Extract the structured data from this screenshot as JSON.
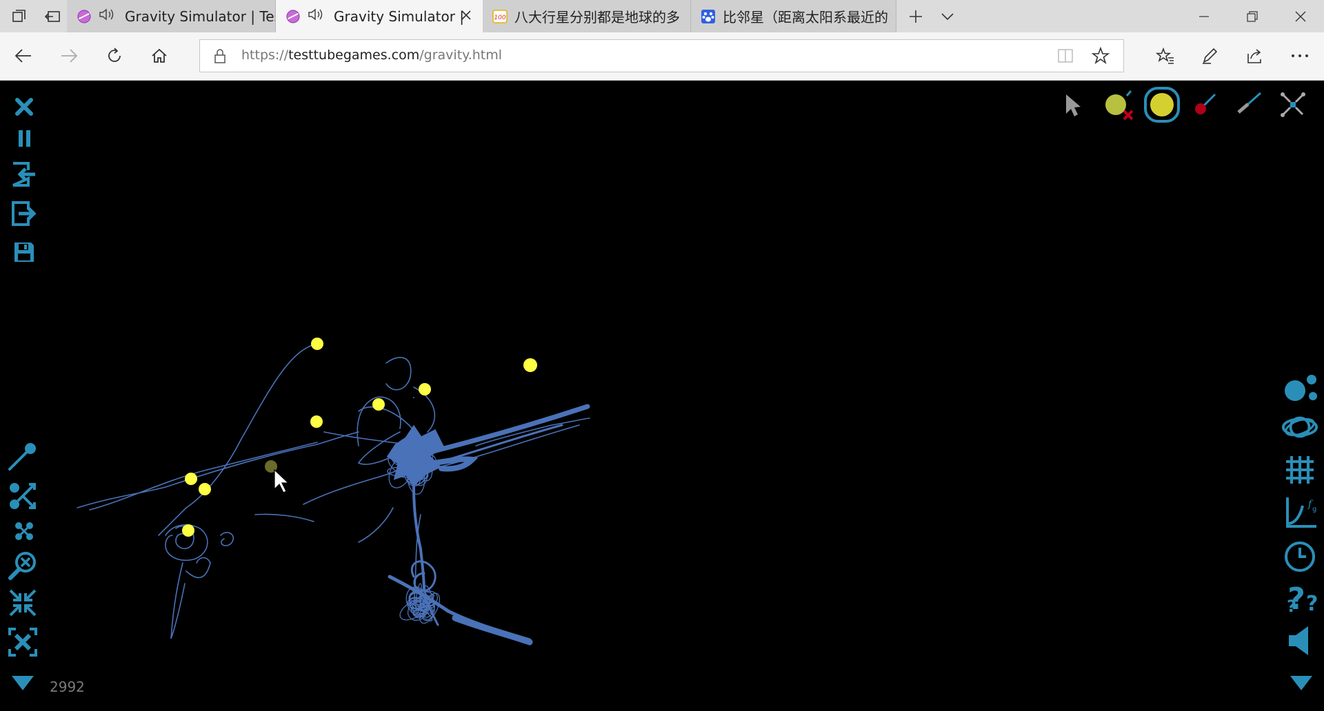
{
  "browser": {
    "tabs": [
      {
        "title": "Gravity Simulator | Test",
        "active": false,
        "favicon": "planet-icon",
        "audio": true
      },
      {
        "title": "Gravity Simulator |",
        "active": true,
        "favicon": "planet-icon",
        "audio": true
      },
      {
        "title": "八大行星分别都是地球的多",
        "active": false,
        "favicon": "page-icon"
      },
      {
        "title": "比邻星（距离太阳系最近的",
        "active": false,
        "favicon": "paw-icon"
      }
    ],
    "url": {
      "scheme": "https://",
      "host": "testtubegames.com",
      "path": "/gravity.html"
    }
  },
  "simulator": {
    "counter": "2992",
    "colors": {
      "background": "#000000",
      "ui": "#2a8fb8",
      "trail": "#4a72b8",
      "body": "#ffff44",
      "ghost_body": "#6b6b2a",
      "tool_red": "#b00018"
    },
    "left_tools": [
      "close-icon",
      "pause-icon",
      "import-icon",
      "export-icon",
      "save-icon",
      "velocity-tool-icon",
      "shuffle-icon",
      "collide-icon",
      "zoom-icon",
      "collapse-icon",
      "center-icon",
      "menu-down-icon"
    ],
    "top_tools": [
      "pointer-icon",
      "add-small-body-icon",
      "add-body-icon",
      "add-red-body-icon",
      "brush-icon",
      "scatter-icon"
    ],
    "right_tools": [
      "bodies-icon",
      "orbit-icon",
      "grid-icon",
      "graph-icon",
      "clock-icon",
      "help-icon",
      "sound-icon",
      "menu-down-icon"
    ],
    "selected_tool": "add-body-icon"
  }
}
